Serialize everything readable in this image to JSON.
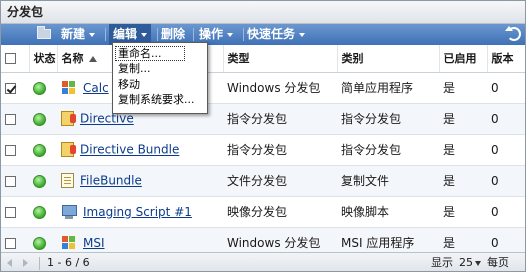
{
  "panel": {
    "title": "分发包"
  },
  "toolbar": {
    "new_label": "新建",
    "edit_label": "编辑",
    "delete_label": "删除",
    "action_label": "操作",
    "quick_task_label": "快速任务"
  },
  "edit_menu": {
    "items": [
      {
        "label": "重命名..."
      },
      {
        "label": "复制..."
      },
      {
        "label": "移动"
      },
      {
        "label": "复制系统要求..."
      }
    ]
  },
  "table": {
    "headers": {
      "status": "状态",
      "name": "名称",
      "type": "类型",
      "category": "类别",
      "enabled": "已启用",
      "version": "版本"
    },
    "rows": [
      {
        "checked": true,
        "icon": "windows-package-icon",
        "name": "Calc",
        "type": "Windows 分发包",
        "category": "简单应用程序",
        "enabled": "是",
        "version": "0"
      },
      {
        "checked": false,
        "icon": "directive-icon",
        "name": "Directive",
        "type": "指令分发包",
        "category": "指令分发包",
        "enabled": "是",
        "version": "0"
      },
      {
        "checked": false,
        "icon": "directive-icon",
        "name": "Directive Bundle",
        "type": "指令分发包",
        "category": "指令分发包",
        "enabled": "是",
        "version": "0"
      },
      {
        "checked": false,
        "icon": "file-bundle-icon",
        "name": "FileBundle",
        "type": "文件分发包",
        "category": "复制文件",
        "enabled": "是",
        "version": "0"
      },
      {
        "checked": false,
        "icon": "imaging-icon",
        "name": "Imaging Script #1",
        "type": "映像分发包",
        "category": "映像脚本",
        "enabled": "是",
        "version": "0"
      },
      {
        "checked": false,
        "icon": "windows-package-icon",
        "name": "MSI",
        "type": "Windows 分发包",
        "category": "MSI 应用程序",
        "enabled": "是",
        "version": "0"
      }
    ]
  },
  "footer": {
    "range": "1 - 6 / 6",
    "show_label": "显示",
    "page_size": "25",
    "each_label": "每页"
  }
}
